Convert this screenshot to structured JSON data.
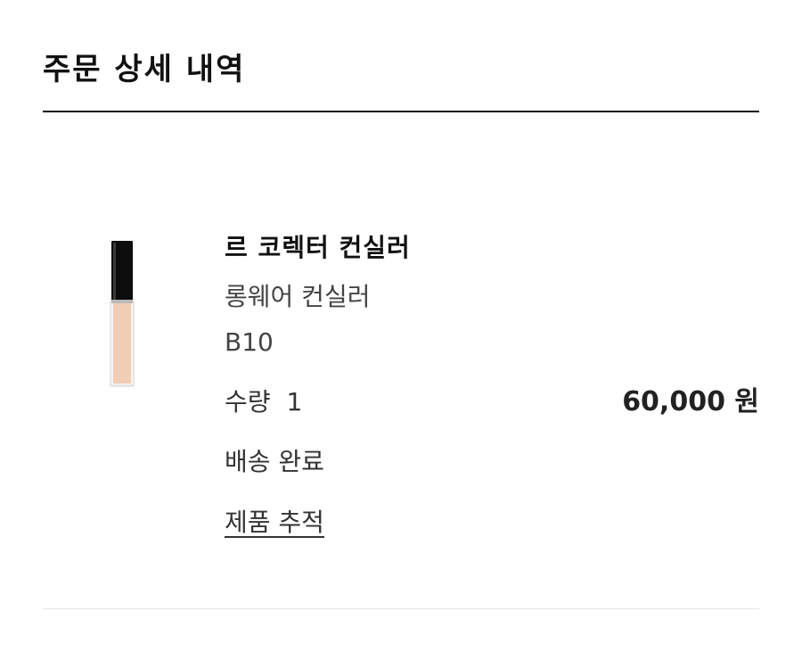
{
  "page": {
    "title": "주문 상세 내역"
  },
  "order_item": {
    "image_icon": "concealer-product-image",
    "name": "르 코렉터 컨실러",
    "subtitle": "롱웨어 컨실러",
    "shade": "B10",
    "quantity_label": "수량",
    "quantity_value": "1",
    "price": "60,000 원",
    "status": "배송 완료",
    "track_link": "제품 추적"
  },
  "colors": {
    "text_primary": "#111111",
    "text_secondary": "#444444",
    "divider_strong": "#111111",
    "divider_light": "#e6e6e6",
    "product_cap": "#0d0d0d",
    "product_body": "#f2cdb5"
  }
}
